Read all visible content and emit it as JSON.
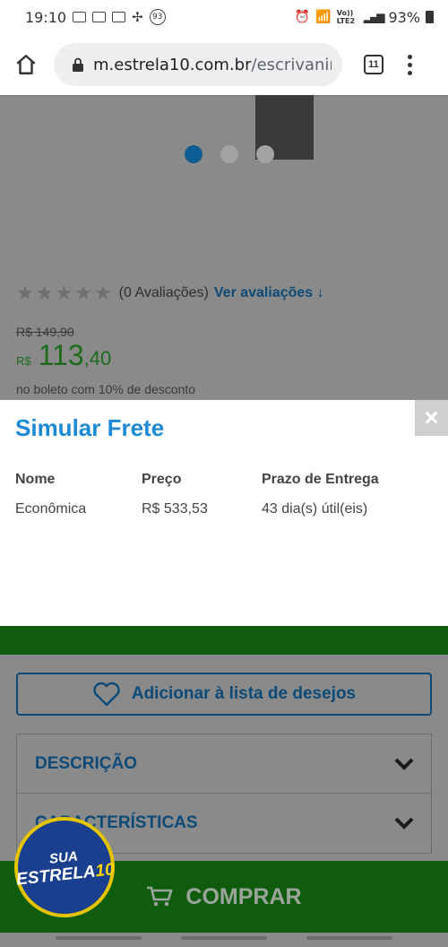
{
  "status_bar": {
    "time": "19:10",
    "notif_count": "93",
    "network": "Vo)) LTE2",
    "battery": "93%"
  },
  "browser": {
    "url_host": "m.estrela10.com.br",
    "url_path": "/escrivanin",
    "tab_count": "11"
  },
  "product": {
    "rating_count": "(0 Avaliações)",
    "see_reviews": "Ver avaliações",
    "old_price": "R$ 149,90",
    "currency": "R$",
    "price_int": "113",
    "price_dec": ",40",
    "boleto_note": "no boleto com 10% de desconto"
  },
  "wishlist": {
    "label": "Adicionar à lista de desejos"
  },
  "accordion": {
    "items": [
      {
        "label": "DESCRIÇÃO"
      },
      {
        "label": "CARACTERÍSTICAS"
      }
    ]
  },
  "buy_button": {
    "label": "COMPRAR"
  },
  "badge": {
    "line1": "SUA",
    "line2": "ESTRELA",
    "line2_num": "10"
  },
  "modal": {
    "title": "Simular Frete",
    "close_symbol": "×",
    "columns": [
      "Nome",
      "Preço",
      "Prazo de Entrega"
    ],
    "rows": [
      [
        "Econômica",
        "R$ 533,53",
        "43 dia(s) útil(eis)"
      ]
    ]
  },
  "colors": {
    "accent_blue": "#1e8ad6",
    "link_blue": "#0d4a78",
    "buy_green": "#0f5c0f",
    "price_green": "#1d6b1d"
  }
}
